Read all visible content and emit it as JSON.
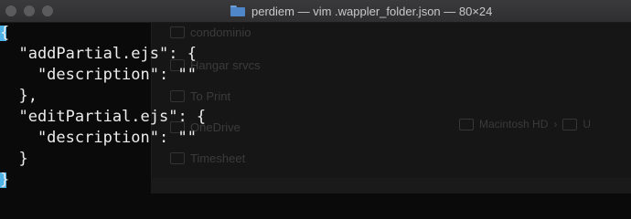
{
  "window": {
    "title": "perdiem — vim .wappler_folder.json — 80×24",
    "title_icon": "folder-icon"
  },
  "editor": {
    "lines": [
      "{",
      "  \"addPartial.ejs\": {",
      "    \"description\": \"\"",
      "  },",
      "  \"editPartial.ejs\": {",
      "    \"description\": \"\"",
      "  }",
      "}"
    ],
    "cursor_color": "#4fb2e6"
  },
  "background_window": {
    "sidebar_items": [
      "condominio",
      "Hangar srvcs",
      "To Print",
      "OneDrive",
      "Timesheet"
    ],
    "path": [
      "Macintosh HD",
      "U"
    ]
  }
}
